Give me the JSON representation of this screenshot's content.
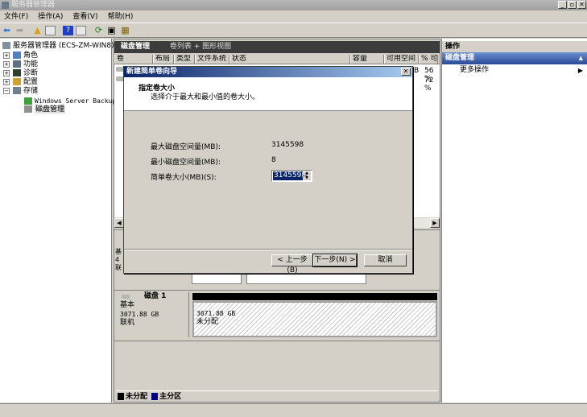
{
  "window": {
    "title": "服务器管理器",
    "controls": [
      "_",
      "▫",
      "✕"
    ]
  },
  "menu": [
    "文件(F)",
    "操作(A)",
    "查看(V)",
    "帮助(H)"
  ],
  "tree": {
    "root": "服务器管理器 (ECS-ZM-WIN8)",
    "items": [
      "角色",
      "功能",
      "诊断",
      "配置",
      "存储"
    ],
    "storage_children": [
      "Windows Server Backup",
      "磁盘管理"
    ]
  },
  "center": {
    "title": "磁盘管理",
    "view": "卷列表 + 图形视图",
    "columns": [
      "卷",
      "布局",
      "类型",
      "文件系统",
      "状态",
      "容量",
      "可用空间",
      "% 可"
    ],
    "rows": [
      {
        "free_tail": "B",
        "pct": "56 %"
      },
      {
        "free_tail": "",
        "pct": "72 %"
      }
    ],
    "disk1": {
      "name": "磁盘 1",
      "type": "基本",
      "size": "3071.88 GB",
      "status": "联机",
      "partition_size": "3071.88 GB",
      "partition_label": "未分配"
    },
    "disk0_partial": {
      "type": "基",
      "size": "4",
      "status": "联"
    },
    "legend": [
      {
        "label": "未分配",
        "color": "#000000"
      },
      {
        "label": "主分区",
        "color": "#000080"
      }
    ]
  },
  "actions": {
    "header": "操作",
    "section": "磁盘管理",
    "more": "更多操作"
  },
  "dialog": {
    "title": "新建简单卷向导",
    "heading": "指定卷大小",
    "subheading": "选择介于最大和最小值的卷大小。",
    "max_label": "最大磁盘空间量(MB):",
    "max_value": "3145598",
    "min_label": "最小磁盘空间量(MB):",
    "min_value": "8",
    "size_label": "简单卷大小(MB)(S):",
    "size_value": "3145598",
    "back": "< 上一步(B)",
    "next": "下一步(N) >",
    "cancel": "取消"
  }
}
